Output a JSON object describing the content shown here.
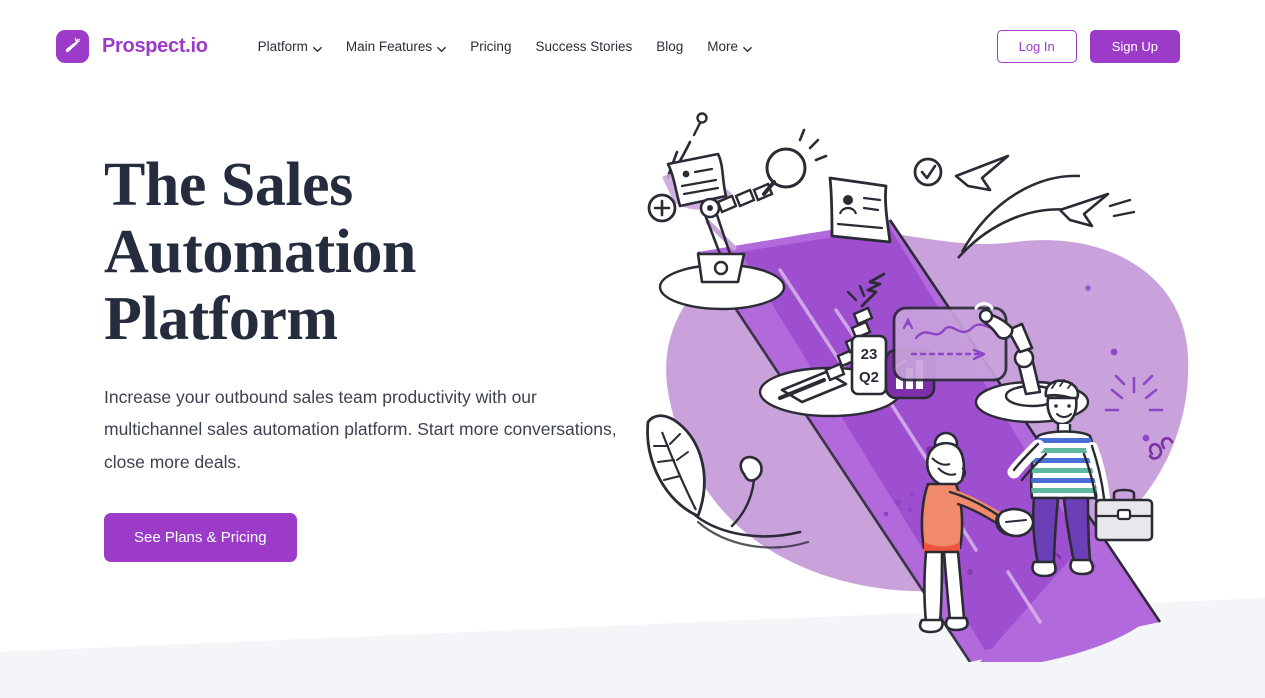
{
  "header": {
    "brand": {
      "icon": "carrot-logo-icon",
      "name": "Prospect.io",
      "color": "#9B3BC8"
    },
    "nav_items": [
      {
        "label": "Platform",
        "has_dropdown": true,
        "icon": "chevron-down-icon"
      },
      {
        "label": "Main Features",
        "has_dropdown": true,
        "icon": "chevron-down-icon"
      },
      {
        "label": "Pricing",
        "has_dropdown": false
      },
      {
        "label": "Success Stories",
        "has_dropdown": false
      },
      {
        "label": "Blog",
        "has_dropdown": false
      },
      {
        "label": "More",
        "has_dropdown": true,
        "icon": "chevron-down-icon"
      }
    ],
    "login_label": "Log In",
    "signup_label": "Sign Up"
  },
  "hero": {
    "title_line_1": "The Sales",
    "title_line_2": "Automation",
    "title_line_3": "Platform",
    "subtitle": "Increase your outbound sales team productivity with our multichannel sales automation platform. Start more conversations, close more deals.",
    "cta_label": "See Plans & Pricing",
    "illustration": {
      "name": "sales-automation-conveyor-illustration",
      "card_label_line_1": "23",
      "card_label_line_2": "Q2",
      "elements": [
        "flying-document-with-plus-badge",
        "robot-arm-with-magnifying-glass",
        "contact-card",
        "check-mark-badge",
        "robot-arm-with-arrow",
        "date-card",
        "bar-chart-icon",
        "analytics-panel",
        "robot-arm-pointing",
        "paper-plane",
        "plant-leaf",
        "flower",
        "woman-in-orange-top",
        "man-with-briefcase",
        "handshake",
        "sparkle-burst"
      ]
    }
  },
  "colors": {
    "brand_purple": "#9B3BC8",
    "deep_purple": "#8E44C7",
    "light_purple_blob": "#C9A2DC",
    "heading_navy": "#242C3E",
    "body_gray": "#3D4250",
    "section_gray": "#F4F5F8",
    "white": "#FFFFFF",
    "coral": "#F08A6A",
    "belt_purple": "#A855D6"
  }
}
